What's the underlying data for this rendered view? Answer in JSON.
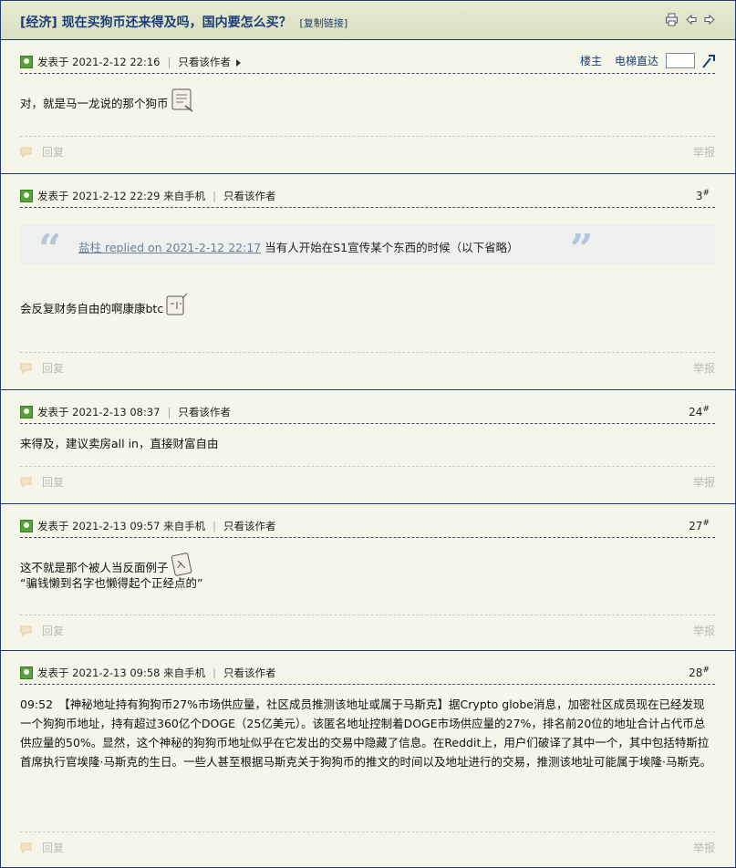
{
  "thread": {
    "category": "[经济]",
    "title": "现在买狗币还来得及吗，国内要怎么买？",
    "copy_link": "[复制链接]"
  },
  "toolbar": {
    "louzhu": "楼主",
    "jump_label": "电梯直达"
  },
  "posts": [
    {
      "posted": "发表于 2021-2-12 22:16",
      "only_author": "只看该作者",
      "content": "对，就是马一龙说的那个狗币",
      "reply": "回复",
      "report": "举报"
    },
    {
      "posted": "发表于 2021-2-12 22:29 来自手机",
      "only_author": "只看该作者",
      "floor": "3",
      "quote_author": "盐柱 replied on 2021-2-12 22:17",
      "quote_text": " 当有人开始在S1宣传某个东西的时候（以下省略）",
      "content": "会反复财务自由的啊康康btc",
      "reply": "回复",
      "report": "举报"
    },
    {
      "posted": "发表于 2021-2-13 08:37",
      "only_author": "只看该作者",
      "floor": "24",
      "content": "来得及，建议卖房all in，直接财富自由",
      "reply": "回复",
      "report": "举报"
    },
    {
      "posted": "发表于 2021-2-13 09:57 来自手机",
      "only_author": "只看该作者",
      "floor": "27",
      "content": "这不就是那个被人当反面例子",
      "content2": "“骗钱懒到名字也懒得起个正经点的”",
      "reply": "回复",
      "report": "举报"
    },
    {
      "posted": "发表于 2021-2-13 09:58 来自手机",
      "only_author": "只看该作者",
      "floor": "28",
      "content": "09:52　【神秘地址持有狗狗币27%市场供应量，社区成员推测该地址或属于马斯克】据Crypto globe消息，加密社区成员现在已经发现一个狗狗币地址，持有超过360亿个DOGE（25亿美元）。该匿名地址控制着DOGE市场供应量的27%，排名前20位的地址合计占代币总供应量的50%。显然，这个神秘的狗狗币地址似乎在它发出的交易中隐藏了信息。在Reddit上，用户们破译了其中一个，其中包括特斯拉首席执行官埃隆·马斯克的生日。一些人甚至根据马斯克关于狗狗币的推文的时间以及地址进行的交易，推测该地址可能属于埃隆·马斯克。",
      "reply": "回复",
      "report": "举报"
    }
  ],
  "floor_mark": "#",
  "colors": {
    "background": "#f5f6e9",
    "border": "#1e3a6e",
    "title": "#1b3d7a",
    "muted": "#b9bcb0"
  }
}
